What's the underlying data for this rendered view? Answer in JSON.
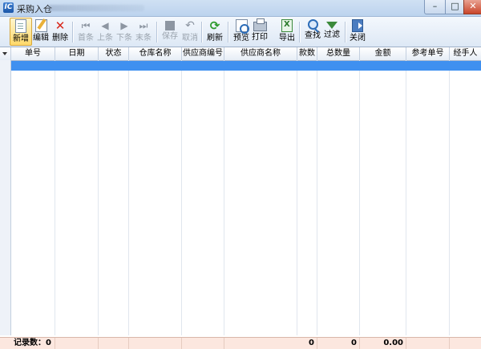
{
  "window": {
    "title": "采购入仓"
  },
  "toolbar": {
    "new": "新增",
    "edit": "编辑",
    "delete": "删除",
    "first": "首条",
    "prev": "上条",
    "next": "下条",
    "last": "末条",
    "save": "保存",
    "cancel": "取消",
    "refresh": "刷新",
    "preview": "预览",
    "print": "打印",
    "export": "导出",
    "find": "查找",
    "filter": "过滤",
    "close": "关闭"
  },
  "grid": {
    "columns": [
      "单号",
      "日期",
      "状态",
      "仓库名称",
      "供应商编号",
      "供应商名称",
      "款数",
      "总数量",
      "金额",
      "参考单号",
      "经手人"
    ],
    "footer": {
      "record_label": "记录数：0",
      "kuanshu": "0",
      "total_qty": "0",
      "amount": "0.00"
    }
  }
}
